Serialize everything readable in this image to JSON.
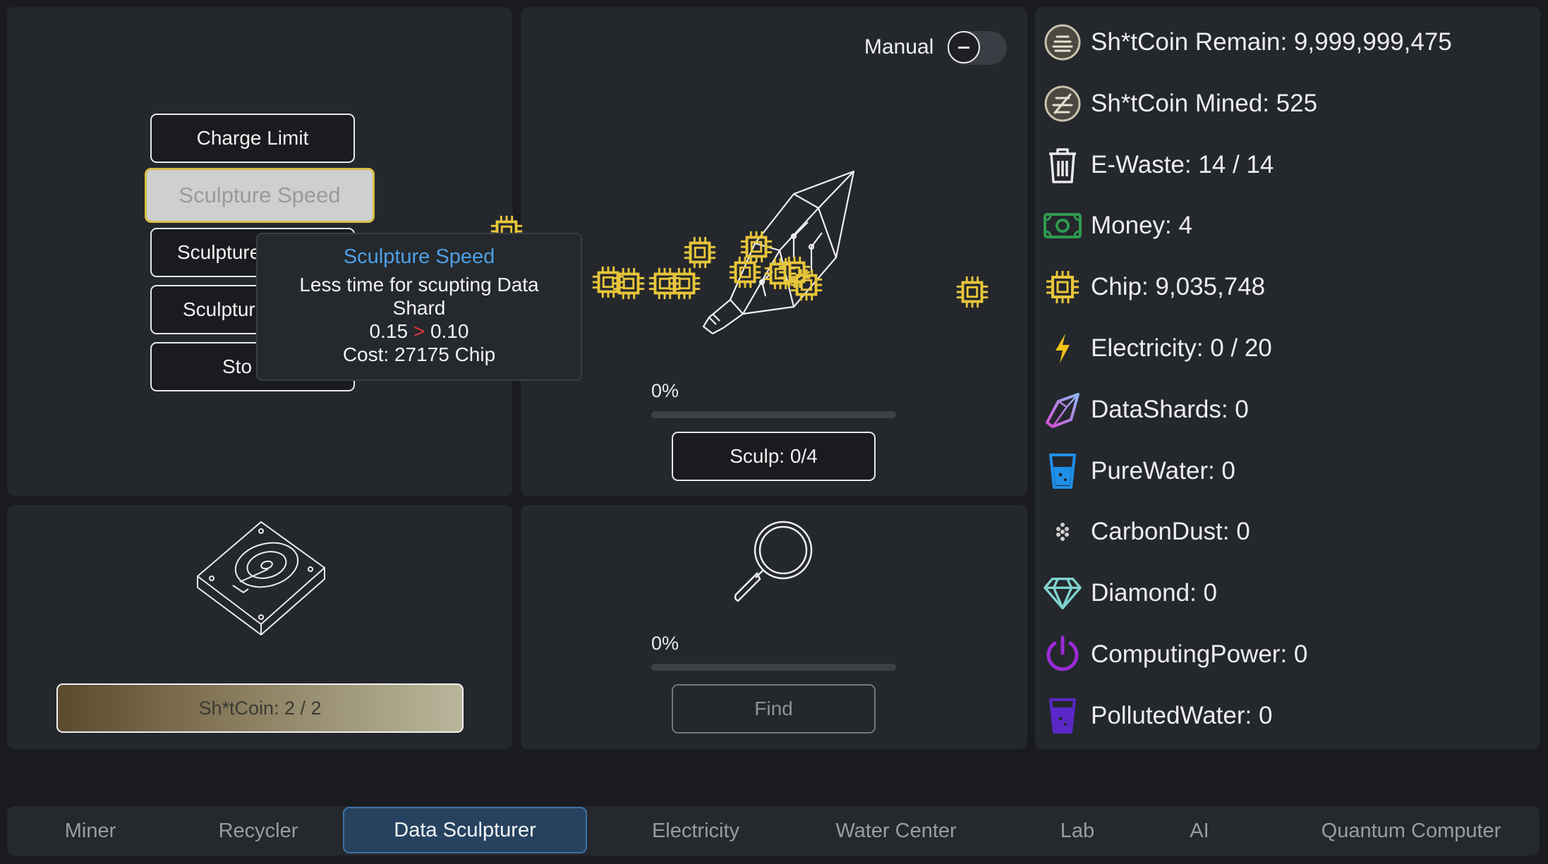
{
  "upgrades": {
    "charge_limit": "Charge Limit",
    "sculpture_speed": "Sculpture Speed",
    "item3": "Sculpture",
    "item4": "Sculptur",
    "item5": "Sto"
  },
  "tooltip": {
    "title": "Sculpture Speed",
    "description": "Less time for scupting Data Shard",
    "from": "0.15",
    "arrow": ">",
    "to": "0.10",
    "cost": "Cost: 27175 Chip"
  },
  "sculptor": {
    "manual_label": "Manual",
    "manual_on": false,
    "progress_text": "0%",
    "progress": 0,
    "button_label": "Sculp: 0/4"
  },
  "storage": {
    "coin_label": "Sh*tCoin: 2  / 2"
  },
  "finder": {
    "progress_text": "0%",
    "progress": 0,
    "button_label": "Find"
  },
  "resources": [
    {
      "label": "Sh*tCoin Remain: 9,999,999,475",
      "icon": "coin-stack-icon"
    },
    {
      "label": "Sh*tCoin Mined: 525",
      "icon": "coin-mined-icon"
    },
    {
      "label": "E-Waste: 14 / 14",
      "icon": "trash-icon"
    },
    {
      "label": "Money: 4",
      "icon": "money-icon"
    },
    {
      "label": "Chip: 9,035,748",
      "icon": "chip-icon"
    },
    {
      "label": "Electricity: 0 / 20",
      "icon": "lightning-icon"
    },
    {
      "label": "DataShards: 0",
      "icon": "data-shard-icon"
    },
    {
      "label": "PureWater: 0",
      "icon": "water-glass-icon"
    },
    {
      "label": "CarbonDust: 0",
      "icon": "dust-icon"
    },
    {
      "label": "Diamond: 0",
      "icon": "diamond-icon"
    },
    {
      "label": "ComputingPower: 0",
      "icon": "power-icon"
    },
    {
      "label": "PollutedWater: 0",
      "icon": "polluted-water-icon"
    }
  ],
  "tabs": [
    "Miner",
    "Recycler",
    "Data Sculpturer",
    "Electricity",
    "Water Center",
    "Lab",
    "AI",
    "Quantum Computer"
  ],
  "active_tab": "Data Sculpturer",
  "colors": {
    "accent_blue": "#4da0e8",
    "chip_yellow": "#e8c63a",
    "active_tab_bg": "#27425f",
    "tooltip_arrow": "#e03a3a"
  }
}
